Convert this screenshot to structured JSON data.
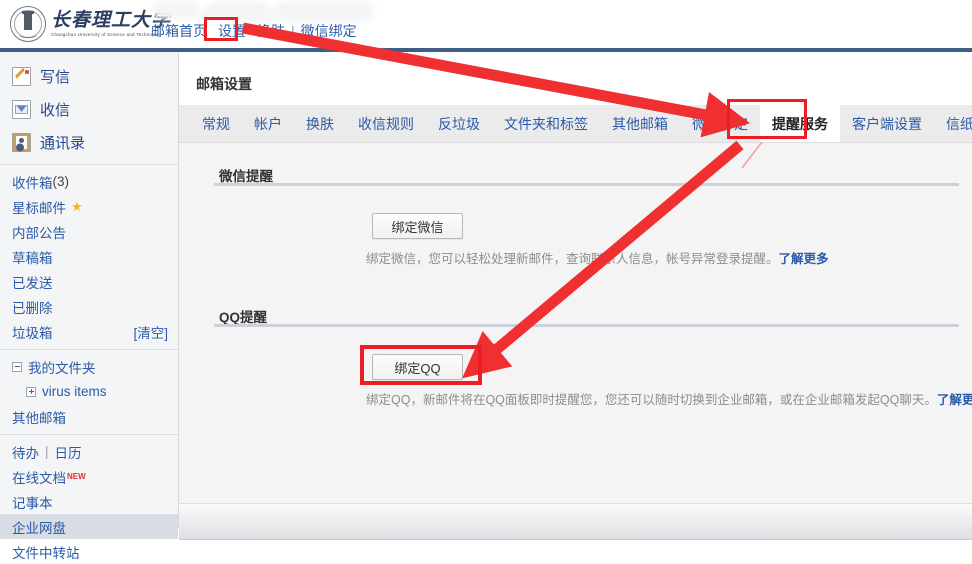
{
  "header": {
    "logo_cn": "长春理工大学",
    "logo_en": "Changchun University of Science and Technology",
    "nav": {
      "home": "邮箱首页",
      "settings": "设置",
      "skin": "换肤",
      "separator": "|",
      "wechat_bind": "微信绑定"
    }
  },
  "sidebar": {
    "main_actions": [
      {
        "label": "写信",
        "icon": "compose-icon"
      },
      {
        "label": "收信",
        "icon": "inbox-icon"
      },
      {
        "label": "通讯录",
        "icon": "contacts-icon"
      }
    ],
    "folders": [
      {
        "label": "收件箱",
        "count": "(3)"
      },
      {
        "label": "星标邮件",
        "star": "★"
      },
      {
        "label": "内部公告"
      },
      {
        "label": "草稿箱"
      },
      {
        "label": "已发送"
      },
      {
        "label": "已删除"
      },
      {
        "label": "垃圾箱",
        "action": "[清空]"
      }
    ],
    "my_folders": [
      {
        "label": "我的文件夹",
        "toggle": "minus"
      },
      {
        "label": "virus items",
        "toggle": "plus",
        "indent": true
      },
      {
        "label": "其他邮箱"
      }
    ],
    "tools": [
      {
        "label": "待办",
        "pipe": "|",
        "label2": "日历"
      },
      {
        "label": "在线文档",
        "badge": "NEW"
      },
      {
        "label": "记事本"
      },
      {
        "label": "企业网盘",
        "selected": true
      },
      {
        "label": "文件中转站"
      }
    ]
  },
  "main": {
    "page_title": "邮箱设置",
    "tabs": [
      {
        "label": "常规",
        "active": false
      },
      {
        "label": "帐户",
        "active": false
      },
      {
        "label": "换肤",
        "active": false
      },
      {
        "label": "收信规则",
        "active": false
      },
      {
        "label": "反垃圾",
        "active": false
      },
      {
        "label": "文件夹和标签",
        "active": false
      },
      {
        "label": "其他邮箱",
        "active": false
      },
      {
        "label": "微信绑定",
        "active": false
      },
      {
        "label": "提醒服务",
        "active": true
      },
      {
        "label": "客户端设置",
        "active": false
      },
      {
        "label": "信纸",
        "active": false
      }
    ],
    "sections": [
      {
        "title": "微信提醒",
        "button": "绑定微信",
        "description": "绑定微信，您可以轻松处理新邮件，查询联系人信息，帐号异常登录提醒。",
        "more": "了解更多"
      },
      {
        "title": "QQ提醒",
        "button": "绑定QQ",
        "description": "绑定QQ，新邮件将在QQ面板即时提醒您，您还可以随时切换到企业邮箱，或在企业邮箱发起QQ聊天。",
        "more": "了解更多"
      }
    ]
  },
  "annotations": {
    "highlight_color": "#ee1c25",
    "boxes": [
      "设置",
      "提醒服务",
      "绑定QQ"
    ],
    "arrows": 2
  }
}
